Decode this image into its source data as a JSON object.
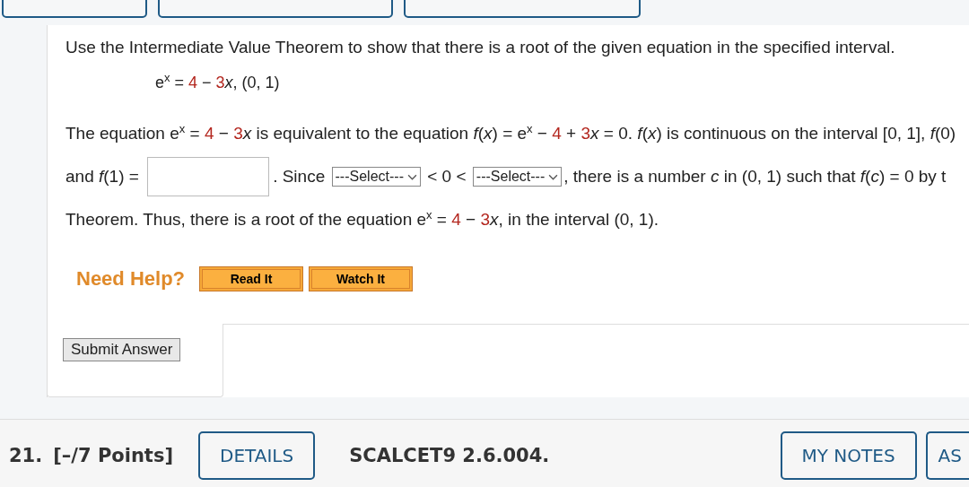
{
  "top_buttons": [
    {
      "kind": "tab"
    },
    {
      "kind": "tab"
    },
    {
      "kind": "tab"
    }
  ],
  "question": {
    "prompt": "Use the Intermediate Value Theorem to show that there is a root of the given equation in the specified interval.",
    "equation": [
      {
        "kind": "text",
        "t": "e$^{x}$ = "
      },
      {
        "kind": "red",
        "t": "4"
      },
      {
        "kind": "text",
        "t": " − "
      },
      {
        "kind": "red",
        "t": "3"
      },
      {
        "kind": "text",
        "t": "*x*,   (0, 1)"
      }
    ],
    "lines": [
      [
        {
          "kind": "text",
          "t": "The equation e$^{x}$ = "
        },
        {
          "kind": "red",
          "t": "4"
        },
        {
          "kind": "text",
          "t": " − "
        },
        {
          "kind": "red",
          "t": "3"
        },
        {
          "kind": "text",
          "t": "*x* is equivalent to the equation *f*(*x*) = e$^{x}$ − "
        },
        {
          "kind": "red",
          "t": "4"
        },
        {
          "kind": "text",
          "t": " + "
        },
        {
          "kind": "red",
          "t": "3"
        },
        {
          "kind": "text",
          "t": "*x* = 0. *f*(*x*) is continuous on the interval [0, 1], *f*(0)"
        }
      ],
      [
        {
          "kind": "text",
          "t": "and *f*(1) = "
        },
        {
          "kind": "input"
        },
        {
          "kind": "text",
          "t": ". Since "
        },
        {
          "kind": "select",
          "t": "---Select---"
        },
        {
          "kind": "text",
          "t": " < 0 < "
        },
        {
          "kind": "select",
          "t": "---Select---"
        },
        {
          "kind": "text",
          "t": ", there is a number *c* in (0, 1) such that *f*(*c*) = 0 by t"
        }
      ],
      [
        {
          "kind": "text",
          "t": "Theorem. Thus, there is a root of the equation e$^{x}$ = "
        },
        {
          "kind": "red",
          "t": "4"
        },
        {
          "kind": "text",
          "t": " − "
        },
        {
          "kind": "red",
          "t": "3"
        },
        {
          "kind": "text",
          "t": "*x*, in the interval (0, 1)."
        }
      ]
    ]
  },
  "help": {
    "label": "Need Help?",
    "buttons": [
      "Read It",
      "Watch It"
    ]
  },
  "submit": "Submit Answer",
  "next": {
    "number": "21.",
    "points": "[–/7 Points]",
    "details": "DETAILS",
    "code": "SCALCET9 2.6.004.",
    "buttons": [
      "MY NOTES",
      "AS"
    ]
  }
}
